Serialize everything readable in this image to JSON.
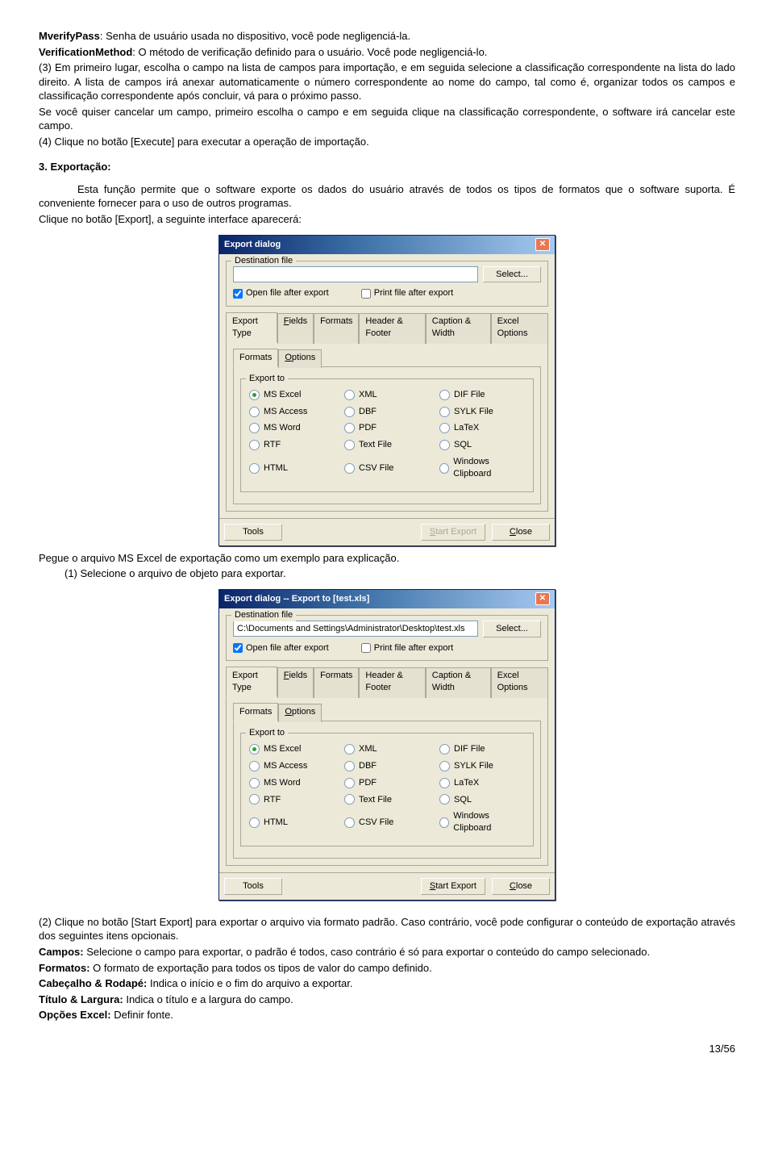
{
  "doc": {
    "p1": "MverifyPass: Senha de usuário usada no dispositivo, você pode negligenciá-la.",
    "p2": "VerificationMethod: O método de verificação definido para o usuário. Você pode negligenciá-lo.",
    "p3": "(3) Em primeiro lugar, escolha o campo na lista de campos para importação, e em seguida selecione a classificação correspondente na lista do lado direito. A lista de campos irá anexar automaticamente o número correspondente ao nome do campo, tal como é, organizar todos os campos e classificação correspondente após concluir, vá para o próximo passo.",
    "p4": "Se você quiser cancelar um campo, primeiro escolha o campo e em seguida clique na classificação correspondente, o software irá cancelar este campo.",
    "p5": "(4) Clique no botão [Execute] para executar a operação de importação.",
    "sec3_title": "3.    Exportação:",
    "p6": "Esta função permite que o software exporte os dados do usuário através de todos os tipos de formatos que o software suporta. É conveniente fornecer para o uso de outros programas.",
    "p7": "Clique no botão [Export], a seguinte interface aparecerá:",
    "p8": "Pegue o arquivo MS Excel de exportação como um exemplo para explicação.",
    "p9": "(1)  Selecione o arquivo de objeto para exportar.",
    "p10": "(2) Clique no botão [Start Export] para exportar o arquivo via formato padrão. Caso contrário, você pode configurar o conteúdo de exportação através dos seguintes itens opcionais.",
    "p11a": "Campos: ",
    "p11b": "Selecione o campo para exportar, o padrão é todos, caso contrário é só para exportar o conteúdo do campo selecionado.",
    "p12a": "Formatos: ",
    "p12b": "O formato de exportação para todos os tipos de valor do campo definido.",
    "p13a": "Cabeçalho & Rodapé: ",
    "p13b": "Indica o início e o fim do arquivo a exportar.",
    "p14a": "Título & Largura: ",
    "p14b": "Indica o título e a largura do campo.",
    "p15a": "Opções Excel: ",
    "p15b": "Definir fonte.",
    "pagenum": "13/56"
  },
  "dialog1": {
    "title": "Export dialog",
    "dest_label": "Destination file",
    "dest_value": "",
    "select_btn": "Select...",
    "open_after": "Open file after export",
    "print_after": "Print file after export",
    "tabs_outer": [
      "Export Type",
      "Fields",
      "Formats",
      "Header & Footer",
      "Caption & Width",
      "Excel Options"
    ],
    "tabs_inner": [
      "Formats",
      "Options"
    ],
    "group_label": "Export to",
    "radios": [
      {
        "label": "MS Excel",
        "checked": true
      },
      {
        "label": "XML",
        "checked": false
      },
      {
        "label": "DIF File",
        "checked": false
      },
      {
        "label": "MS Access",
        "checked": false
      },
      {
        "label": "DBF",
        "checked": false
      },
      {
        "label": "SYLK File",
        "checked": false
      },
      {
        "label": "MS Word",
        "checked": false
      },
      {
        "label": "PDF",
        "checked": false
      },
      {
        "label": "LaTeX",
        "checked": false
      },
      {
        "label": "RTF",
        "checked": false
      },
      {
        "label": "Text File",
        "checked": false
      },
      {
        "label": "SQL",
        "checked": false
      },
      {
        "label": "HTML",
        "checked": false
      },
      {
        "label": "CSV File",
        "checked": false
      },
      {
        "label": "Windows Clipboard",
        "checked": false
      }
    ],
    "tools_btn": "Tools",
    "start_btn": "Start Export",
    "close_btn": "Close",
    "start_disabled": true
  },
  "dialog2": {
    "title": "Export dialog  --  Export to [test.xls]",
    "dest_value": "C:\\Documents and Settings\\Administrator\\Desktop\\test.xls",
    "start_disabled": false
  }
}
